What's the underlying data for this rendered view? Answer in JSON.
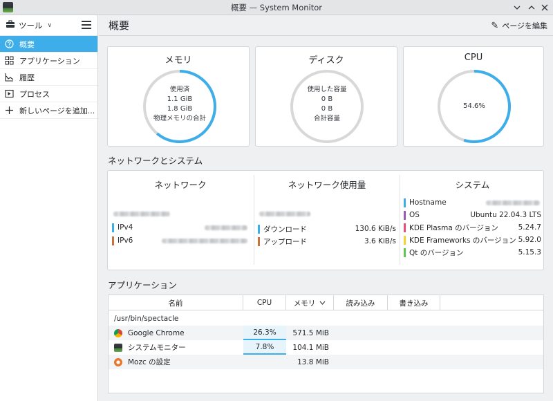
{
  "window": {
    "title": "概要 — System Monitor"
  },
  "sidebar": {
    "tools_label": "ツール",
    "items": [
      {
        "label": "概要",
        "icon": "overview-icon",
        "active": true
      },
      {
        "label": "アプリケーション",
        "icon": "grid-icon",
        "active": false
      },
      {
        "label": "履歴",
        "icon": "history-chart-icon",
        "active": false
      },
      {
        "label": "プロセス",
        "icon": "process-icon",
        "active": false
      },
      {
        "label": "新しいページを追加...",
        "icon": "plus-icon",
        "active": false
      }
    ]
  },
  "header": {
    "page_title": "概要",
    "edit_label": "ページを編集"
  },
  "memory": {
    "title": "メモリ",
    "used_label": "使用済",
    "used_value": "1.1 GiB",
    "total_value": "1.8 GiB",
    "total_label": "物理メモリの合計",
    "fraction": 0.61,
    "color": "#3daee9"
  },
  "disk": {
    "title": "ディスク",
    "used_label": "使用した容量",
    "used_value": "0 B",
    "total_value": "0 B",
    "total_label": "合計容量",
    "fraction": 0.0
  },
  "cpu": {
    "title": "CPU",
    "value": "54.6%",
    "fraction": 0.546
  },
  "network_section": {
    "title": "ネットワークとシステム",
    "network": {
      "title": "ネットワーク",
      "ipv4_label": "IPv4",
      "ipv6_label": "IPv6",
      "ipv4_color": "#3daee9",
      "ipv6_color": "#c8733e"
    },
    "usage": {
      "title": "ネットワーク使用量",
      "download_label": "ダウンロード",
      "download_value": "130.6 KiB/s",
      "upload_label": "アップロード",
      "upload_value": "3.6 KiB/s",
      "download_color": "#3daee9",
      "upload_color": "#c8733e"
    },
    "system": {
      "title": "システム",
      "rows": [
        {
          "label": "Hostname",
          "value": "",
          "color": "#3daee9"
        },
        {
          "label": "OS",
          "value": "Ubuntu 22.04.3 LTS",
          "color": "#9b59b6"
        },
        {
          "label": "KDE Plasma のバージョン",
          "value": "5.24.7",
          "color": "#e84e7a"
        },
        {
          "label": "KDE Frameworks のバージョン",
          "value": "5.92.0",
          "color": "#f6d32d"
        },
        {
          "label": "Qt のバージョン",
          "value": "5.15.3",
          "color": "#5ec84e"
        }
      ]
    }
  },
  "apps_section": {
    "title": "アプリケーション",
    "columns": [
      "名前",
      "CPU",
      "メモリ",
      "読み込み",
      "書き込み"
    ],
    "rows": [
      {
        "name": "/usr/bin/spectacle",
        "cpu": "",
        "memory": "",
        "icon": ""
      },
      {
        "name": "Google Chrome",
        "cpu": "26.3%",
        "memory": "571.5 MiB",
        "icon": "chrome-icon"
      },
      {
        "name": "システムモニター",
        "cpu": "7.8%",
        "memory": "104.1 MiB",
        "icon": "system-monitor-icon"
      },
      {
        "name": "Mozc の設定",
        "cpu": "",
        "memory": "13.8 MiB",
        "icon": "mozc-icon"
      }
    ]
  }
}
